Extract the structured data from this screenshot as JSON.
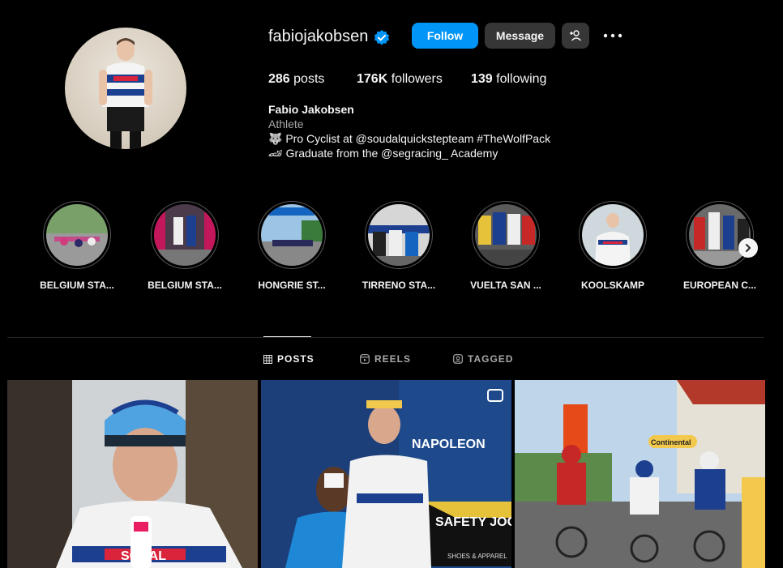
{
  "profile": {
    "username": "fabiojakobsen",
    "follow_label": "Follow",
    "message_label": "Message",
    "posts_count": "286",
    "posts_label": "posts",
    "followers_count": "176K",
    "followers_label": "followers",
    "following_count": "139",
    "following_label": "following",
    "full_name": "Fabio Jakobsen",
    "category": "Athlete",
    "bio_line1": "🐺  Pro Cyclist at @soudalquickstepteam #TheWolfPack",
    "bio_line2": "🏎  Graduate from the @segracing_ Academy"
  },
  "highlights": [
    {
      "label": "BELGIUM STA..."
    },
    {
      "label": "BELGIUM STA..."
    },
    {
      "label": "HONGRIE ST..."
    },
    {
      "label": "TIRRENO STA..."
    },
    {
      "label": "VUELTA SAN ..."
    },
    {
      "label": "KOOLSKAMP"
    },
    {
      "label": "EUROPEAN C..."
    }
  ],
  "tabs": [
    {
      "label": "POSTS"
    },
    {
      "label": "REELS"
    },
    {
      "label": "TAGGED"
    }
  ],
  "posts": [
    {
      "text": "SODAL"
    },
    {
      "text": "NAPOLEON",
      "text2": "SAFETY JOGGER",
      "text3": "SHOES & APPAREL"
    },
    {
      "text": "Continental"
    }
  ],
  "colors": {
    "accent": "#0095f6",
    "background": "#000000",
    "button_secondary": "#363636"
  }
}
